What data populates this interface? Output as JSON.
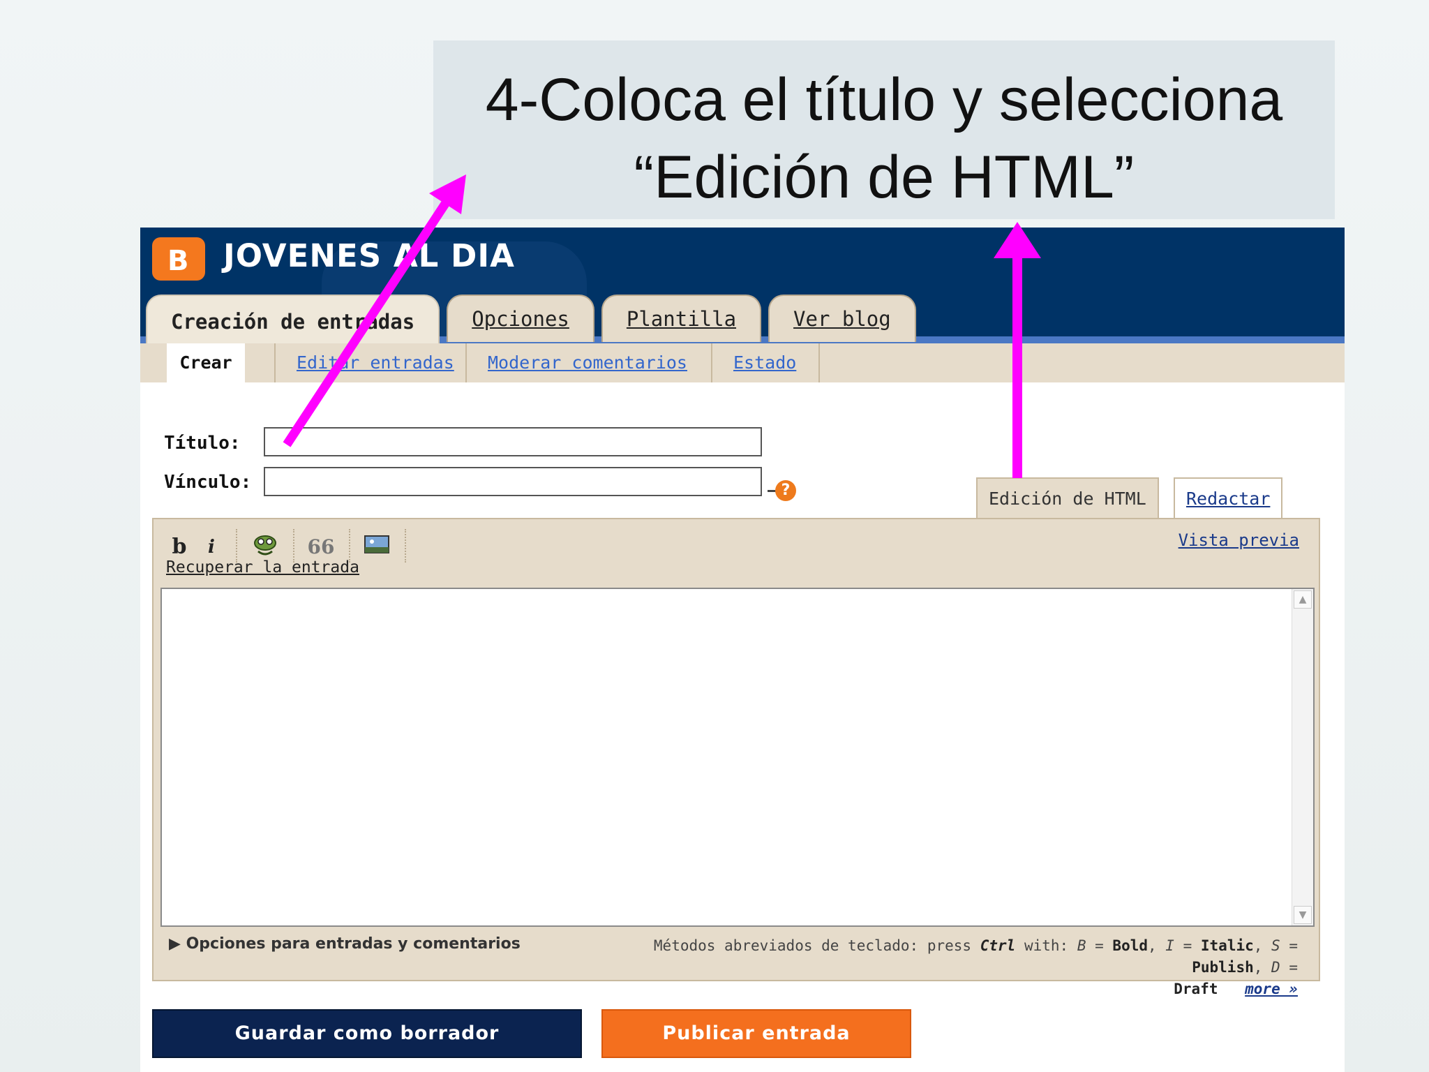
{
  "slide": {
    "title_line1": "4-Coloca el título y selecciona",
    "title_line2": "“Edición de HTML”"
  },
  "blog": {
    "logo_letter": "B",
    "name": "JOVENES AL DIA"
  },
  "tabs": [
    {
      "label": "Creación de entradas",
      "active": true
    },
    {
      "label": "Opciones",
      "active": false
    },
    {
      "label": "Plantilla",
      "active": false
    },
    {
      "label": "Ver blog",
      "active": false
    }
  ],
  "subnav": [
    {
      "label": "Crear",
      "current": true
    },
    {
      "label": "Editar entradas",
      "current": false
    },
    {
      "label": "Moderar comentarios",
      "current": false
    },
    {
      "label": "Estado",
      "current": false
    }
  ],
  "form": {
    "title_label": "Título:",
    "title_value": "",
    "link_label": "Vínculo:",
    "link_value": "",
    "help_symbol": "?"
  },
  "editor": {
    "mode_html": "Edición de HTML",
    "mode_compose": "Redactar",
    "toolbar": {
      "bold": "b",
      "italic": "i",
      "quote": "66"
    },
    "recover": "Recuperar la entrada",
    "preview": "Vista previa",
    "content": "",
    "options": "Opciones para entradas y comentarios",
    "shortcuts": {
      "prefix": "Métodos abreviados de teclado: press",
      "ctrl": "Ctrl",
      "with": "with:",
      "b_key": "B",
      "b_action": "Bold",
      "i_key": "I",
      "i_action": "Italic",
      "s_key": "S",
      "s_action": "Publish",
      "d_key": "D",
      "d_action": "Draft",
      "more": "more »"
    }
  },
  "buttons": {
    "save_draft": "Guardar como borrador",
    "publish": "Publicar entrada"
  },
  "colors": {
    "header": "#003366",
    "accent_orange": "#f46f1e",
    "annotation_arrow": "#ff00ff"
  }
}
